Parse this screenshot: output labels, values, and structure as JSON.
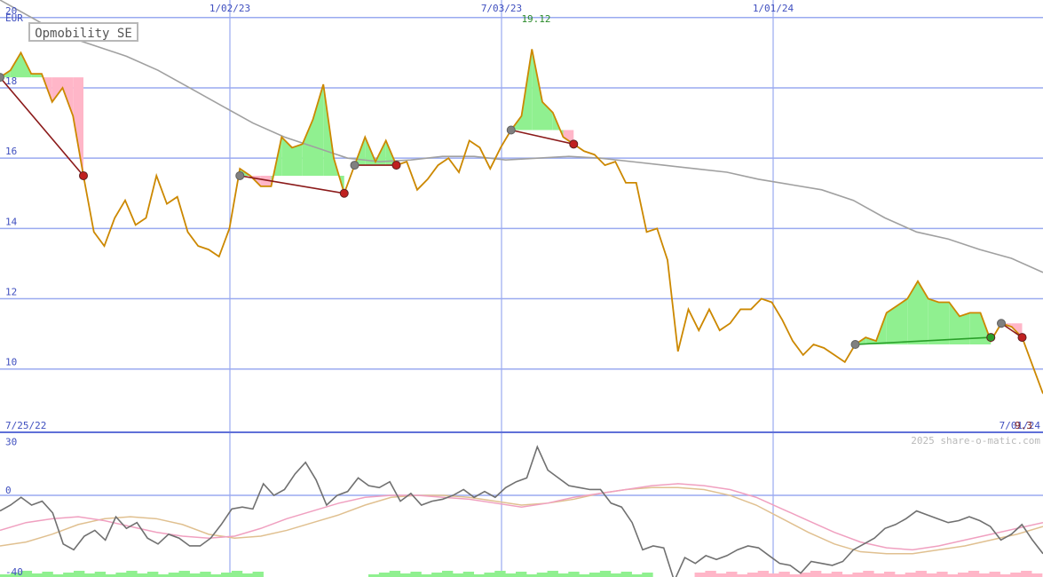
{
  "title": "Opmobility SE",
  "currency": "EUR",
  "watermark": "2025 share-o-matic.com",
  "peak_label": "19.12",
  "last_value_label": "9.3",
  "colors": {
    "price": "#cc8800",
    "moving_average": "#a0a0a0",
    "grid": "#9aaaf0",
    "gain_fill": "#90f090",
    "loss_fill": "#ffb6c8",
    "loss_trade": "#8b1a1a",
    "gain_trade": "#2aa02a",
    "oscillator": "#707070",
    "osc_pink": "#f0a0c0",
    "osc_tan": "#e0c090"
  },
  "chart_data": [
    {
      "type": "line",
      "panel": "price",
      "x_axis": [
        "7/25/22",
        "1/02/23",
        "7/03/23",
        "1/01/24",
        "7/01/24"
      ],
      "y_ticks": [
        10,
        12,
        14,
        16,
        18,
        20
      ],
      "ylim": [
        8.2,
        20.5
      ],
      "series": [
        {
          "name": "",
          "role": "price",
          "values": [
            18.3,
            18.5,
            19.0,
            18.4,
            18.4,
            17.6,
            18.0,
            17.2,
            15.5,
            13.9,
            13.5,
            14.3,
            14.8,
            14.1,
            14.3,
            15.5,
            14.7,
            14.9,
            13.9,
            13.5,
            13.4,
            13.2,
            14.0,
            15.7,
            15.5,
            15.2,
            15.2,
            16.6,
            16.3,
            16.4,
            17.1,
            18.1,
            16.0,
            15.0,
            15.8,
            16.6,
            15.9,
            16.5,
            15.8,
            15.9,
            15.1,
            15.4,
            15.8,
            16.0,
            15.6,
            16.5,
            16.3,
            15.7,
            16.3,
            16.8,
            17.2,
            19.1,
            17.6,
            17.3,
            16.6,
            16.4,
            16.2,
            16.1,
            15.8,
            15.9,
            15.3,
            15.3,
            13.9,
            14.0,
            13.1,
            10.5,
            11.7,
            11.1,
            11.7,
            11.1,
            11.3,
            11.7,
            11.7,
            12.0,
            11.9,
            11.4,
            10.8,
            10.4,
            10.7,
            10.6,
            10.4,
            10.2,
            10.7,
            10.9,
            10.8,
            11.6,
            11.8,
            12.0,
            12.5,
            12.0,
            11.9,
            11.9,
            11.5,
            11.6,
            11.6,
            10.8,
            11.3,
            11.2,
            10.9,
            10.1,
            9.3
          ]
        },
        {
          "name": "",
          "role": "moving_average",
          "values": [
            20.5,
            20.0,
            19.5,
            19.2,
            18.9,
            18.5,
            18.0,
            17.5,
            17.0,
            16.6,
            16.3,
            16.0,
            15.9,
            15.95,
            16.05,
            16.05,
            15.95,
            16.0,
            16.05,
            16.0,
            15.9,
            15.8,
            15.7,
            15.6,
            15.4,
            15.25,
            15.1,
            14.8,
            14.3,
            13.9,
            13.7,
            13.4,
            13.15,
            12.75
          ]
        }
      ],
      "trades": [
        {
          "from_index": 0,
          "from_value": 18.3,
          "to_index": 8,
          "to_value": 15.5,
          "result": "loss"
        },
        {
          "from_index": 23,
          "from_value": 15.5,
          "to_index": 33,
          "to_value": 15.0,
          "result": "loss"
        },
        {
          "from_index": 34,
          "from_value": 15.8,
          "to_index": 38,
          "to_value": 15.8,
          "result": "loss"
        },
        {
          "from_index": 49,
          "from_value": 16.8,
          "to_index": 55,
          "to_value": 16.4,
          "result": "loss"
        },
        {
          "from_index": 82,
          "from_value": 10.7,
          "to_index": 95,
          "to_value": 10.9,
          "result": "gain"
        },
        {
          "from_index": 96,
          "from_value": 11.3,
          "to_index": 98,
          "to_value": 10.9,
          "result": "loss"
        }
      ]
    },
    {
      "type": "line",
      "panel": "oscillator",
      "y_ticks": [
        30,
        0,
        -40
      ],
      "ylim": [
        -42,
        32
      ],
      "series": [
        {
          "name": "",
          "role": "oscillator",
          "values": [
            -8,
            -5,
            -1,
            -5,
            -3,
            -9,
            -25,
            -28,
            -21,
            -18,
            -23,
            -11,
            -17,
            -14,
            -22,
            -25,
            -20,
            -22,
            -26,
            -26,
            -22,
            -15,
            -7,
            -6,
            -7,
            6,
            0,
            3,
            11,
            17,
            8,
            -5,
            0,
            2,
            9,
            5,
            4,
            7,
            -3,
            1,
            -5,
            -3,
            -2,
            0,
            3,
            -1,
            2,
            -1,
            4,
            7,
            9,
            25,
            13,
            9,
            5,
            4,
            3,
            3,
            -4,
            -6,
            -14,
            -28,
            -26,
            -27,
            -44,
            -32,
            -35,
            -31,
            -33,
            -31,
            -28,
            -26,
            -27,
            -31,
            -35,
            -36,
            -40,
            -34,
            -35,
            -36,
            -34,
            -28,
            -25,
            -22,
            -17,
            -15,
            -12,
            -8,
            -10,
            -12,
            -14,
            -13,
            -11,
            -13,
            -16,
            -23,
            -20,
            -15,
            -23,
            -30
          ]
        },
        {
          "name": "",
          "role": "signal_pink",
          "values": [
            -18,
            -14,
            -12,
            -11,
            -13,
            -16,
            -19,
            -21,
            -22,
            -21,
            -17,
            -12,
            -8,
            -4,
            -1,
            0,
            0,
            -1,
            -2,
            -4,
            -6,
            -4,
            -1,
            1,
            3,
            5,
            6,
            5,
            3,
            -1,
            -7,
            -13,
            -19,
            -24,
            -27,
            -28,
            -26,
            -23,
            -20,
            -17,
            -14
          ]
        },
        {
          "name": "",
          "role": "signal_tan",
          "values": [
            -26,
            -24,
            -20,
            -15,
            -12,
            -11,
            -12,
            -15,
            -20,
            -22,
            -21,
            -18,
            -14,
            -10,
            -5,
            -1,
            0,
            0,
            -1,
            -3,
            -5,
            -4,
            -2,
            1,
            3,
            4,
            4,
            3,
            0,
            -5,
            -12,
            -19,
            -25,
            -29,
            -30,
            -30,
            -28,
            -26,
            -23,
            -20,
            -16
          ]
        }
      ],
      "volume_bars": {
        "positive_blocks": 30,
        "negative_blocks": 29
      }
    }
  ]
}
